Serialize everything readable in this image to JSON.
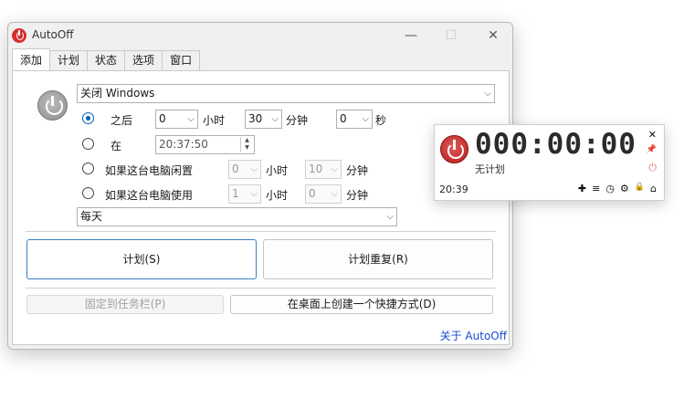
{
  "window": {
    "title": "AutoOff",
    "minimize": "—",
    "maximize": "☐",
    "close": "✕"
  },
  "tabs": [
    "添加",
    "计划",
    "状态",
    "选项",
    "窗口"
  ],
  "action": {
    "selected": "关闭 Windows"
  },
  "after": {
    "label": "之后",
    "hours_value": "0",
    "hours_unit": "小时",
    "minutes_value": "30",
    "minutes_unit": "分钟",
    "seconds_value": "0",
    "seconds_unit": "秒"
  },
  "at": {
    "label": "在",
    "time_value": "20:37:50"
  },
  "idle": {
    "label": "如果这台电脑闲置",
    "hours_value": "0",
    "hours_unit": "小时",
    "minutes_value": "10",
    "minutes_unit": "分钟"
  },
  "used": {
    "label": "如果这台电脑使用",
    "hours_value": "1",
    "hours_unit": "小时",
    "minutes_value": "0",
    "minutes_unit": "分钟"
  },
  "repeat": {
    "selected": "每天"
  },
  "buttons": {
    "schedule": "计划(S)",
    "schedule_repeat": "计划重复(R)",
    "pin_taskbar": "固定到任务栏(P)",
    "create_shortcut": "在桌面上创建一个快捷方式(D)"
  },
  "about_link": "关于 AutoOff",
  "widget": {
    "countdown": "000:00:00",
    "status": "无计划",
    "clock": "20:39",
    "tools": {
      "add": "✚",
      "list": "≡",
      "timer": "◷",
      "settings": "⚙",
      "lock": "🔒",
      "home": "⌂"
    },
    "close": "✕",
    "pin": "📌",
    "shutdown": "⏻"
  },
  "colors": {
    "accent": "#005fb8",
    "power_red": "#c62828",
    "link": "#1a4bd6"
  }
}
